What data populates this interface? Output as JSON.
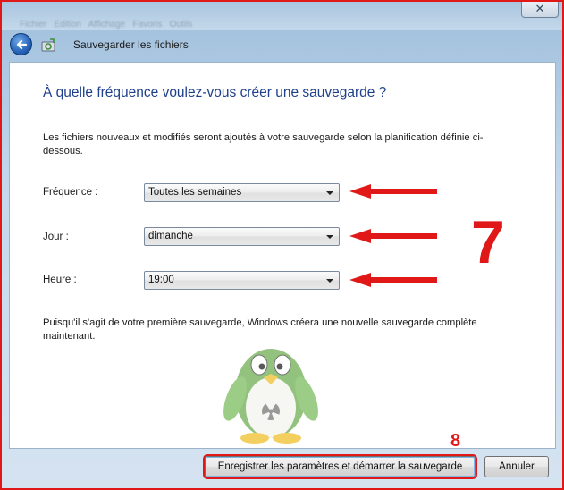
{
  "window": {
    "close_glyph": "✕"
  },
  "nav": {
    "title": "Sauvegarder les fichiers",
    "back_icon": "back-arrow-icon",
    "app_icon": "backup-icon"
  },
  "page": {
    "heading": "À quelle fréquence voulez-vous créer une sauvegarde ?",
    "description": "Les fichiers nouveaux et modifiés seront ajoutés à votre sauvegarde selon la planification définie ci-dessous.",
    "note": "Puisqu'il s'agit de votre première sauvegarde, Windows créera une nouvelle sauvegarde complète maintenant."
  },
  "fields": {
    "frequency": {
      "label": "Fréquence :",
      "value": "Toutes les semaines"
    },
    "day": {
      "label": "Jour :",
      "value": "dimanche"
    },
    "time": {
      "label": "Heure :",
      "value": "19:00"
    }
  },
  "annotations": {
    "step7": "7",
    "step8": "8",
    "color": "#e01818"
  },
  "buttons": {
    "save_start": "Enregistrer les paramètres et démarrer la sauvegarde",
    "cancel": "Annuler"
  }
}
